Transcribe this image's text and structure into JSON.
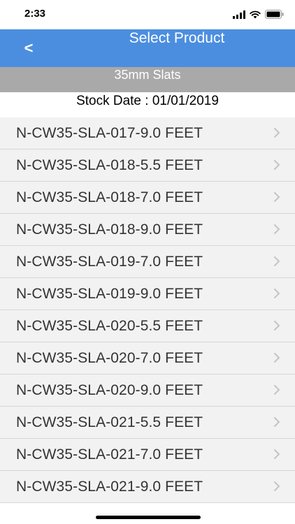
{
  "status_bar": {
    "time": "2:33"
  },
  "nav": {
    "back_label": "<",
    "title": "Select Product"
  },
  "category": "35mm Slats",
  "stock_date": "Stock Date : 01/01/2019",
  "products": [
    "N-CW35-SLA-017-9.0 FEET",
    "N-CW35-SLA-018-5.5 FEET",
    "N-CW35-SLA-018-7.0 FEET",
    "N-CW35-SLA-018-9.0 FEET",
    "N-CW35-SLA-019-7.0 FEET",
    "N-CW35-SLA-019-9.0 FEET",
    "N-CW35-SLA-020-5.5 FEET",
    "N-CW35-SLA-020-7.0 FEET",
    "N-CW35-SLA-020-9.0 FEET",
    "N-CW35-SLA-021-5.5 FEET",
    "N-CW35-SLA-021-7.0 FEET",
    "N-CW35-SLA-021-9.0 FEET"
  ],
  "colors": {
    "nav_background": "#4b8ee0",
    "category_background": "#a9a9a9",
    "row_background": "#f2f2f2",
    "row_text": "#333333",
    "chevron": "#c4c4c4"
  },
  "icons": {
    "row_disclosure": "chevron-right-icon",
    "signal": "cellular-signal-icon",
    "wifi": "wifi-icon",
    "battery": "battery-icon"
  }
}
